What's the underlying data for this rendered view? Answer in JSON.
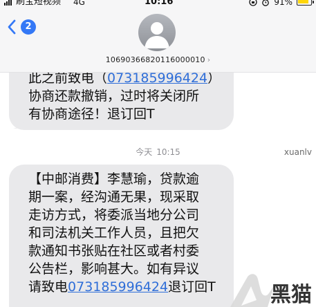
{
  "status_bar": {
    "carrier": "刷宝短视频",
    "network": "4G",
    "time": "10:16",
    "battery": "91%",
    "battery_level": 0.91
  },
  "header": {
    "unread_count": "2",
    "contact_number": "10690366820116000010",
    "contact_chevron": "›"
  },
  "messages": [
    {
      "lines": [
        {
          "before": "此之前致电（",
          "link": "073185996424",
          "after": "）"
        },
        {
          "before": "协商还款撤销，过时将关闭所",
          "link": "",
          "after": ""
        },
        {
          "before": "有协商途径！退订回T",
          "link": "",
          "after": ""
        }
      ]
    },
    {
      "lines": [
        {
          "before": "【中邮消费】李慧瑜，贷款逾",
          "link": "",
          "after": ""
        },
        {
          "before": "期一案，经沟通无果，现采取",
          "link": "",
          "after": ""
        },
        {
          "before": "走访方式，将委派当地分公司",
          "link": "",
          "after": ""
        },
        {
          "before": "和司法机关工作人员，且把欠",
          "link": "",
          "after": ""
        },
        {
          "before": "款通知书张贴在社区或者村委",
          "link": "",
          "after": ""
        },
        {
          "before": "公告栏，影响甚大。如有异议",
          "link": "",
          "after": ""
        },
        {
          "before": "请致电",
          "link": "073185996424",
          "after": "退订回T"
        }
      ]
    }
  ],
  "timestamp": {
    "day": "今天",
    "time": "10:15"
  },
  "watermarks": {
    "small_text": "xuanlv",
    "logo_text": "黑猫"
  },
  "colors": {
    "bubble": "#e9e9eb",
    "link": "#2f6ed8",
    "badge": "#3478f6",
    "header": "#f6f6f7"
  },
  "icons": {
    "back": "chevron-left-icon",
    "avatar": "person-silhouette-icon",
    "battery": "battery-icon",
    "signal": "signal-bars-icon",
    "lock": "lock-rotation-icon",
    "alarm": "alarm-icon"
  }
}
